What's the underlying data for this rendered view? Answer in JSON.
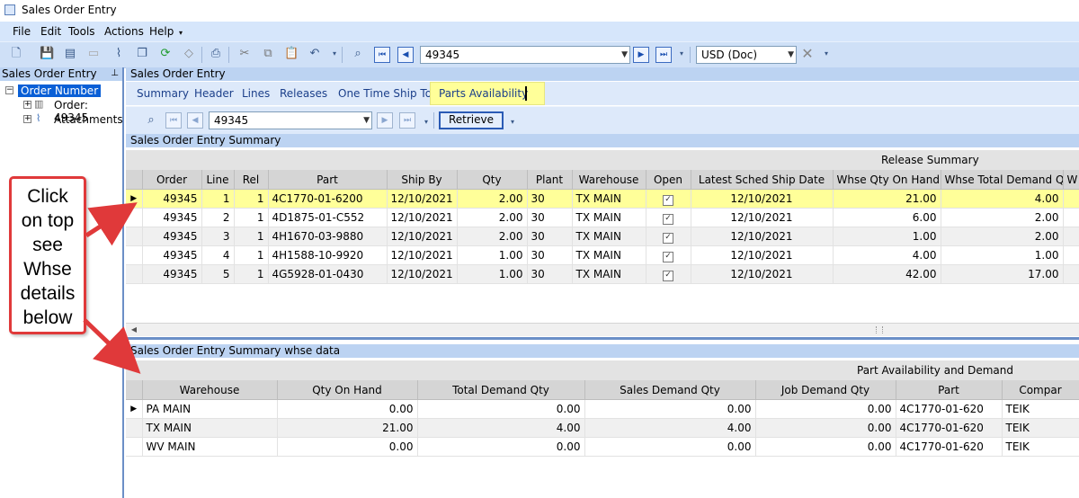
{
  "window": {
    "title": "Sales Order Entry"
  },
  "menu": [
    "File",
    "Edit",
    "Tools",
    "Actions",
    "Help"
  ],
  "toolbar": {
    "order_combo": "49345",
    "currency_combo": "USD (Doc)"
  },
  "left_panel": {
    "title": "Sales Order Entry",
    "tree": {
      "root": "Order Number",
      "items": [
        "Order: 49345",
        "Attachments"
      ]
    }
  },
  "main": {
    "title": "Sales Order Entry",
    "tabs": [
      "Summary",
      "Header",
      "Lines",
      "Releases",
      "One Time Ship To",
      "Parts Availability"
    ],
    "sub_order_combo": "49345",
    "retrieve_label": "Retrieve",
    "summary_section": {
      "title": "Sales Order Entry Summary",
      "band_label": "Release Summary",
      "columns": [
        "Order",
        "Line",
        "Rel",
        "Part",
        "Ship By",
        "Qty",
        "Plant",
        "Warehouse",
        "Open",
        "Latest Sched Ship Date",
        "Whse Qty On Hand",
        "Whse Total Demand Qty",
        "W"
      ],
      "rows": [
        [
          "49345",
          "1",
          "1",
          "4C1770-01-6200",
          "12/10/2021",
          "2.00",
          "30",
          "TX MAIN",
          "✓",
          "12/10/2021",
          "21.00",
          "4.00"
        ],
        [
          "49345",
          "2",
          "1",
          "4D1875-01-C552",
          "12/10/2021",
          "2.00",
          "30",
          "TX MAIN",
          "✓",
          "12/10/2021",
          "6.00",
          "2.00"
        ],
        [
          "49345",
          "3",
          "1",
          "4H1670-03-9880",
          "12/10/2021",
          "2.00",
          "30",
          "TX MAIN",
          "✓",
          "12/10/2021",
          "1.00",
          "2.00"
        ],
        [
          "49345",
          "4",
          "1",
          "4H1588-10-9920",
          "12/10/2021",
          "1.00",
          "30",
          "TX MAIN",
          "✓",
          "12/10/2021",
          "4.00",
          "1.00"
        ],
        [
          "49345",
          "5",
          "1",
          "4G5928-01-0430",
          "12/10/2021",
          "1.00",
          "30",
          "TX MAIN",
          "✓",
          "12/10/2021",
          "42.00",
          "17.00"
        ]
      ]
    },
    "whse_section": {
      "title": "Sales Order Entry Summary whse data",
      "band_label": "Part Availability and Demand",
      "columns": [
        "Warehouse",
        "Qty On Hand",
        "Total Demand Qty",
        "Sales Demand Qty",
        "Job Demand Qty",
        "Part",
        "Compar"
      ],
      "rows": [
        [
          "PA MAIN",
          "0.00",
          "0.00",
          "0.00",
          "0.00",
          "4C1770-01-620",
          "TEIK"
        ],
        [
          "TX MAIN",
          "21.00",
          "4.00",
          "4.00",
          "0.00",
          "4C1770-01-620",
          "TEIK"
        ],
        [
          "WV MAIN",
          "0.00",
          "0.00",
          "0.00",
          "0.00",
          "4C1770-01-620",
          "TEIK"
        ]
      ]
    }
  },
  "callout": {
    "lines": [
      "Click",
      "on top",
      "see",
      "Whse",
      "details",
      "below"
    ]
  },
  "colors": {
    "highlight": "#ffff99",
    "callout_border": "#e0393a",
    "selection": "#0a5fd6",
    "header_blue": "#bcd3f2"
  }
}
